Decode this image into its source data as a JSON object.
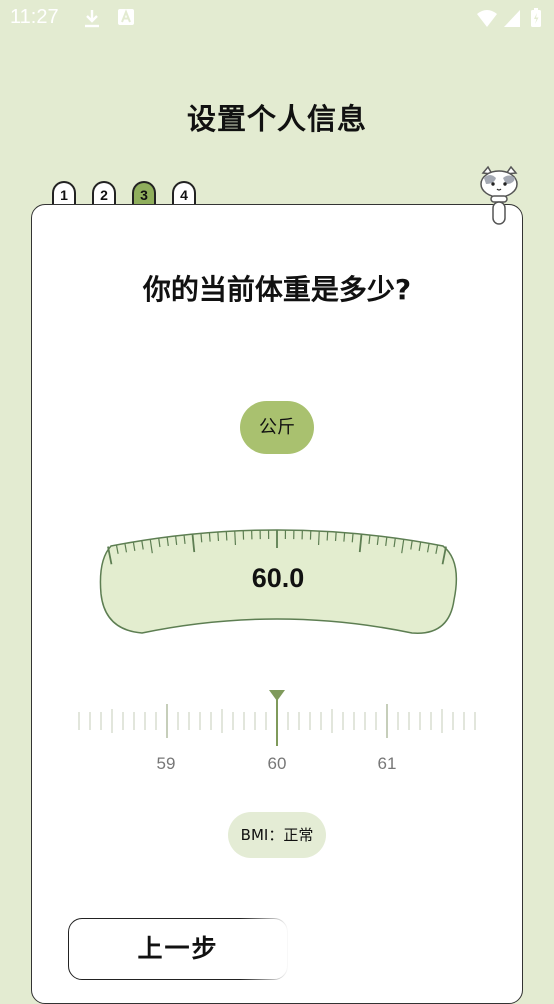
{
  "status_bar": {
    "time": "11:27",
    "icons": [
      "download-icon",
      "a-icon",
      "wifi-icon",
      "signal-icon",
      "battery-icon"
    ]
  },
  "header": {
    "title": "设置个人信息"
  },
  "steps": [
    {
      "label": "1"
    },
    {
      "label": "2"
    },
    {
      "label": "3"
    },
    {
      "label": "4"
    }
  ],
  "current_step": 3,
  "question": "你的当前体重是多少?",
  "unit": "公斤",
  "weight": {
    "value": "60.0"
  },
  "ruler": {
    "labels": [
      "59",
      "60",
      "61"
    ],
    "selected": 60
  },
  "bmi": {
    "text": "BMI：正常"
  },
  "buttons": {
    "prev_label": "上一步"
  },
  "colors": {
    "background": "#e3ebd1",
    "accent": "#a9c16f",
    "active_step": "#8fae5c",
    "scale_fill": "#e3edcf",
    "scale_stroke": "#5d7e52"
  }
}
